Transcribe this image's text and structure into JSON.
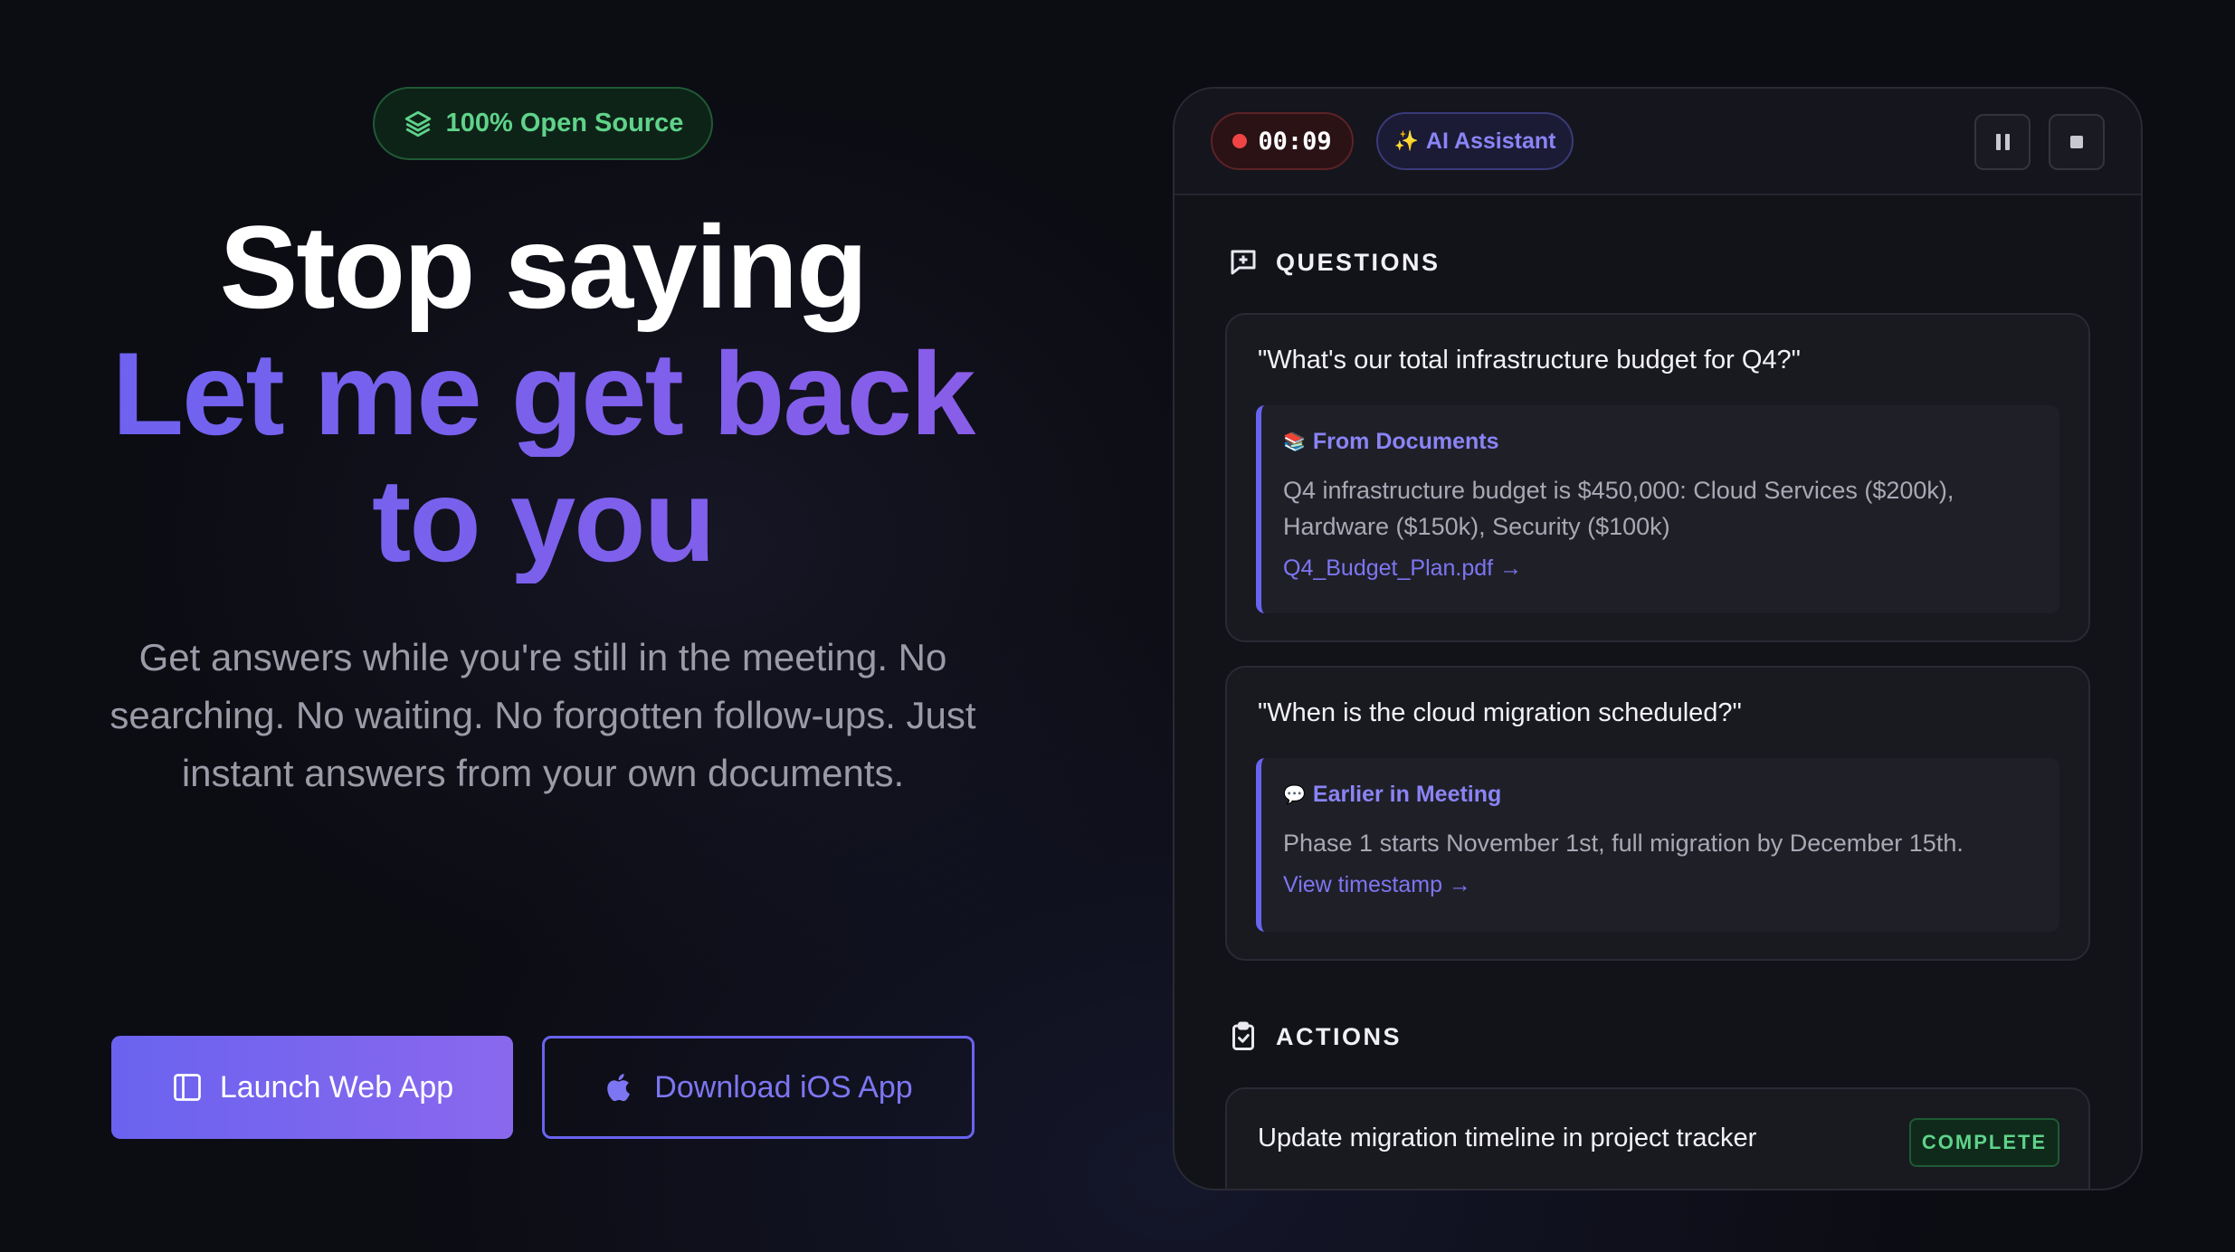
{
  "hero": {
    "badge_label": "100% Open Source",
    "headline_line1": "Stop saying",
    "headline_line2": "Let me get back",
    "headline_line3": "to you",
    "subtitle": "Get answers while you're still in the meeting. No searching. No waiting. No forgotten follow-ups. Just instant answers from your own documents.",
    "primary_button": "Launch Web App",
    "secondary_button": "Download iOS App"
  },
  "panel": {
    "timer": "00:09",
    "ai_label": "AI Assistant",
    "questions_heading": "QUESTIONS",
    "questions": [
      {
        "question": "\"What's our total infrastructure budget for Q4?\"",
        "source_icon": "📚",
        "source": "From Documents",
        "answer": "Q4 infrastructure budget is $450,000: Cloud Services ($200k), Hardware ($150k), Security ($100k)",
        "link": "Q4_Budget_Plan.pdf →"
      },
      {
        "question": "\"When is the cloud migration scheduled?\"",
        "source_icon": "💬",
        "source": "Earlier in Meeting",
        "answer": "Phase 1 starts November 1st, full migration by December 15th.",
        "link": "View timestamp →"
      }
    ],
    "actions_heading": "ACTIONS",
    "actions": [
      {
        "text": "Update migration timeline in project tracker",
        "status": "COMPLETE"
      }
    ]
  },
  "colors": {
    "accent": "#6a63ef",
    "success": "#5fd38a",
    "record": "#ef4444",
    "background": "#0c0c13"
  }
}
